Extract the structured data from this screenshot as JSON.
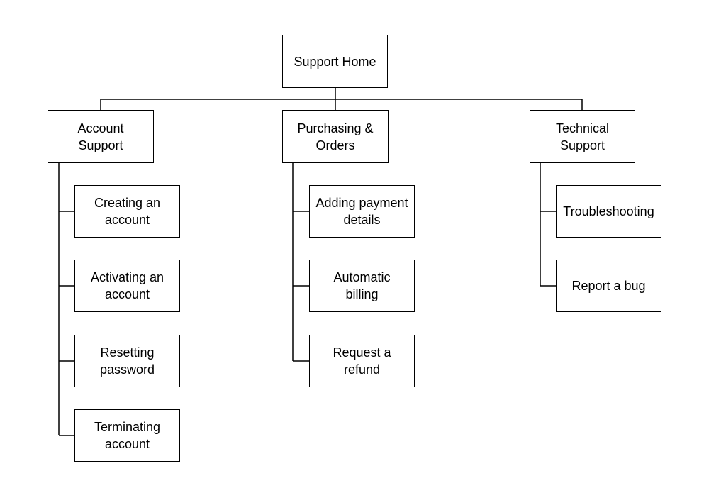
{
  "root": {
    "label": "Support Home"
  },
  "categories": [
    {
      "label": "Account Support",
      "children": [
        "Creating an account",
        "Activating an account",
        "Resetting password",
        "Terminating account"
      ]
    },
    {
      "label": "Purchasing & Orders",
      "children": [
        "Adding payment details",
        "Automatic billing",
        "Request a refund"
      ]
    },
    {
      "label": "Technical Support",
      "children": [
        "Troubleshooting",
        "Report a bug"
      ]
    }
  ]
}
